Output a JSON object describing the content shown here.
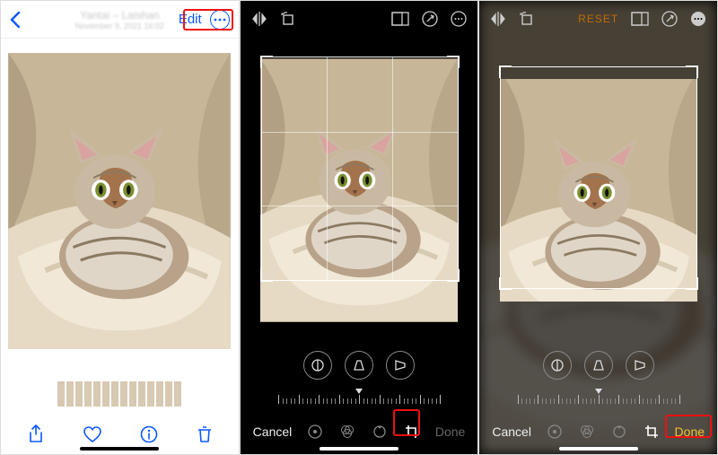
{
  "panel1": {
    "title": "Yantai – Laishan",
    "subtitle": "November 9, 2021  16:02",
    "edit_label": "Edit",
    "more_label": "···",
    "bottom_icons": {
      "share": "share-icon",
      "heart": "heart-icon",
      "info": "info-icon",
      "trash": "trash-icon"
    }
  },
  "editor": {
    "reset_label": "RESET",
    "cancel_label": "Cancel",
    "done_label": "Done",
    "done_inactive": "Done",
    "top_icons": {
      "flip": "flip-icon",
      "rotate": "rotate-icon",
      "aspect": "aspect-icon",
      "markup": "markup-icon",
      "more": "more-icon"
    },
    "tool_icons": {
      "straighten": "straighten-icon",
      "vertical": "vertical-perspective-icon",
      "horizontal": "horizontal-perspective-icon"
    },
    "mode_icons": {
      "adjust": "adjust-icon",
      "filters": "filters-icon",
      "rotate2": "rotate-icon",
      "crop": "crop-icon"
    }
  }
}
